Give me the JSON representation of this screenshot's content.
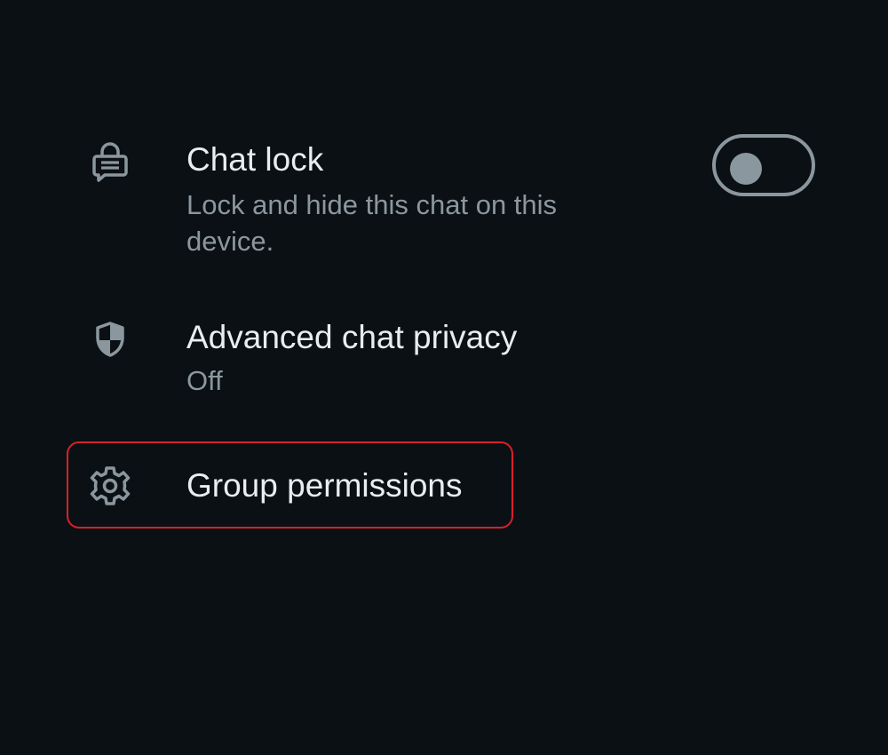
{
  "settings": {
    "chat_lock": {
      "title": "Chat lock",
      "subtitle": "Lock and hide this chat on this device.",
      "icon": "chat-lock-icon",
      "toggle_on": false
    },
    "advanced_privacy": {
      "title": "Advanced chat privacy",
      "subtitle": "Off",
      "icon": "shield-icon"
    },
    "group_permissions": {
      "title": "Group permissions",
      "icon": "gear-icon"
    }
  },
  "colors": {
    "background": "#0b1014",
    "title_text": "#e9edef",
    "subtitle_text": "#8b979e",
    "icon": "#8b979e",
    "highlight_border": "#d8202a"
  }
}
